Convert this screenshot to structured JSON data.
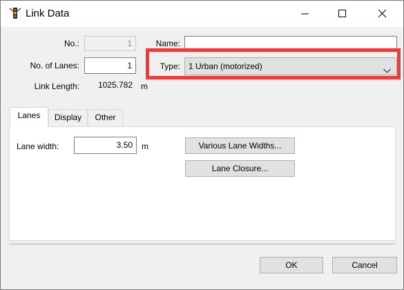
{
  "window": {
    "title": "Link Data"
  },
  "header": {
    "no_label": "No.:",
    "no_value": "1",
    "lanes_label": "No. of Lanes:",
    "lanes_value": "1",
    "length_label": "Link Length:",
    "length_value": "1025.782",
    "length_unit": "m",
    "name_label": "Name:",
    "name_value": "",
    "type_label": "Type:",
    "type_value": "1 Urban (motorized)"
  },
  "tabs": [
    {
      "label": "Lanes",
      "active": true
    },
    {
      "label": "Display",
      "active": false
    },
    {
      "label": "Other",
      "active": false
    }
  ],
  "lanes_tab": {
    "lane_width_label": "Lane width:",
    "lane_width_value": "3.50",
    "lane_width_unit": "m",
    "various_widths_button": "Various Lane Widths...",
    "lane_closure_button": "Lane Closure..."
  },
  "footer": {
    "ok_label": "OK",
    "cancel_label": "Cancel"
  },
  "colors": {
    "highlight": "#f03a3a",
    "dialog_bg": "#f0f0f0",
    "button_bg": "#e1e1e1"
  },
  "icons": [
    "traffic-light-icon",
    "minimize-icon",
    "maximize-icon",
    "close-icon",
    "chevron-down-icon"
  ]
}
